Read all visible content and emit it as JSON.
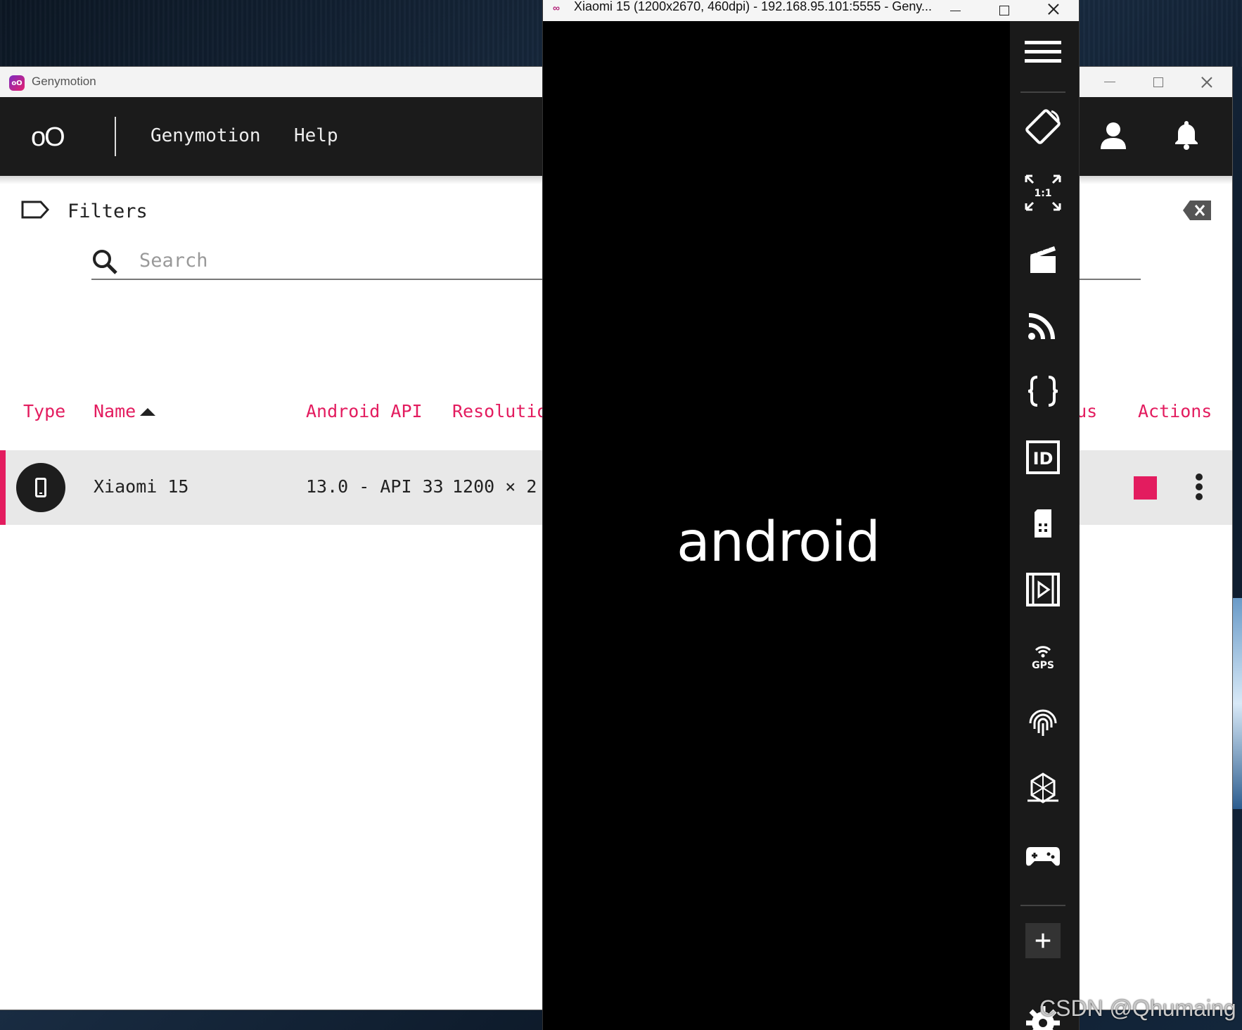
{
  "main_window": {
    "title": "Genymotion",
    "logo_text": "oO",
    "menu": [
      "Genymotion",
      "Help"
    ],
    "filters_label": "Filters",
    "search": {
      "placeholder": "Search",
      "value": ""
    },
    "columns": {
      "type": "Type",
      "name": "Name",
      "android_api": "Android API",
      "resolution": "Resolutio",
      "status": "atus",
      "actions": "Actions"
    },
    "sort": {
      "column": "Name",
      "direction": "ascending"
    },
    "devices": [
      {
        "name": "Xiaomi 15",
        "android_api": "13.0 - API 33",
        "resolution": "1200 × 2"
      }
    ],
    "colors": {
      "accent": "#e31c5f",
      "header": "#1b1b1b"
    }
  },
  "device_window": {
    "title": "Xiaomi 15 (1200x2670, 460dpi) - 192.168.95.101:5555 - Geny...",
    "app_icon": "∞",
    "screen_text": "android",
    "toolbar": [
      "menu-icon",
      "rotate-icon",
      "pixel-perfect-icon",
      "capture-icon",
      "cast-icon",
      "json-icon",
      "device-id-icon",
      "sim-icon",
      "media-icon",
      "gps-icon",
      "fingerprint-icon",
      "motion-sensor-icon",
      "gamepad-icon",
      "add-widget-icon",
      "settings-icon"
    ],
    "toolbar_labels": {
      "pixel_perfect": "1:1",
      "id": "ID",
      "gps": "GPS",
      "add": "+"
    }
  },
  "watermark": "CSDN @Qhumaing"
}
